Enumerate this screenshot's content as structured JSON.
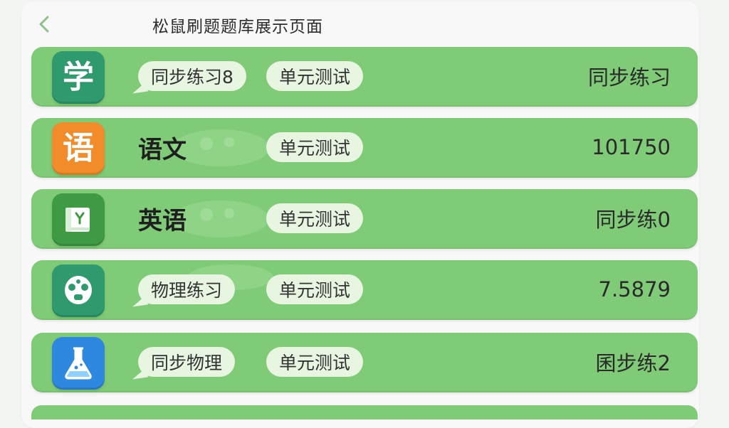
{
  "header": {
    "title": "松鼠刷题题库展示页面",
    "back_icon": "chevron-left-icon"
  },
  "colors": {
    "row_green": "#7fcb77",
    "chip_bg": "#e7f5e1",
    "tile_teal": "#2f9a6d",
    "tile_orange": "#f28c2b",
    "tile_green": "#3f9b43",
    "tile_blue": "#2f88e0"
  },
  "rows": [
    {
      "icon": "xue-character-icon",
      "tile_text": "学",
      "chip": "同步练习8",
      "unit_chip": "单元测试",
      "value": "同步练习"
    },
    {
      "icon": "yu-character-icon",
      "tile_text": "语",
      "title": "语文",
      "unit_chip": "单元测试",
      "value": "101750"
    },
    {
      "icon": "book-icon",
      "title": "英语",
      "unit_chip": "单元测试",
      "value": "同步练0"
    },
    {
      "icon": "alien-face-icon",
      "chip": "物理练习",
      "unit_chip": "单元测试",
      "value": "7.5879"
    },
    {
      "icon": "flask-icon",
      "chip": "同步物理",
      "unit_chip": "单元测试",
      "value": "囷步练2"
    }
  ]
}
